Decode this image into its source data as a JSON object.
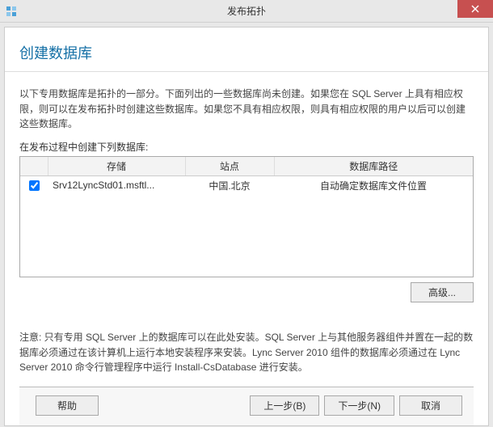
{
  "window": {
    "title": "发布拓扑"
  },
  "header": {
    "page_title": "创建数据库"
  },
  "main": {
    "description": "以下专用数据库是拓扑的一部分。下面列出的一些数据库尚未创建。如果您在 SQL Server 上具有相应权限，则可以在发布拓扑时创建这些数据库。如果您不具有相应权限，则具有相应权限的用户以后可以创建这些数据库。",
    "sub_label": "在发布过程中创建下列数据库:",
    "columns": {
      "store": "存储",
      "site": "站点",
      "path": "数据库路径"
    },
    "rows": [
      {
        "checked": true,
        "store": "Srv12LyncStd01.msftl...",
        "site": "中国.北京",
        "path": "自动确定数据库文件位置"
      }
    ],
    "advanced_label": "高级...",
    "note": "注意: 只有专用 SQL Server 上的数据库可以在此处安装。SQL Server 上与其他服务器组件并置在一起的数据库必须通过在该计算机上运行本地安装程序来安装。Lync Server 2010 组件的数据库必须通过在 Lync Server 2010 命令行管理程序中运行 Install-CsDatabase 进行安装。"
  },
  "footer": {
    "help": "帮助",
    "back": "上一步(B)",
    "next": "下一步(N)",
    "cancel": "取消"
  }
}
